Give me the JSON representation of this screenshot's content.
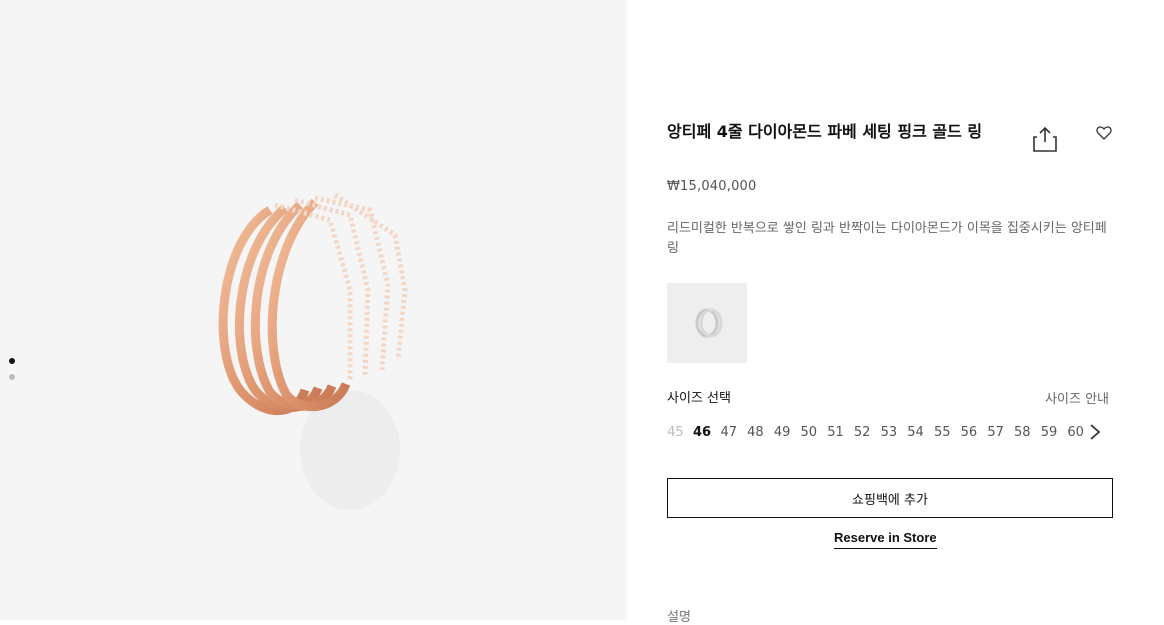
{
  "gallery": {
    "image": "pink-gold-diamond-ring-photo",
    "dots": [
      true,
      false
    ]
  },
  "product": {
    "title": "앙티페 4줄 다이아몬드 파베 세팅 핑크 골드 링",
    "price": "₩15,040,000",
    "description": "리드미컬한 반복으로 쌓인 링과 반짝이는 다이아몬드가 이목을 집중시키는 앙티페 링",
    "variant_thumbnail": "white-gold-ring-variant"
  },
  "actions": {
    "share_icon": "share-icon",
    "wishlist_icon": "heart-icon"
  },
  "size": {
    "label": "사이즈 선택",
    "guide": "사이즈 안내",
    "options": [
      "45",
      "46",
      "47",
      "48",
      "49",
      "50",
      "51",
      "52",
      "53",
      "54",
      "55",
      "56",
      "57",
      "58",
      "59",
      "60"
    ],
    "selected": "46",
    "disabled": [
      "45"
    ]
  },
  "buttons": {
    "add_to_bag": "쇼핑백에 추가",
    "reserve": "Reserve in Store"
  },
  "sections": {
    "description_heading": "설명"
  },
  "colors": {
    "gallery_bg": "#f5f5f5",
    "ring_gold": "#e8a27c"
  }
}
